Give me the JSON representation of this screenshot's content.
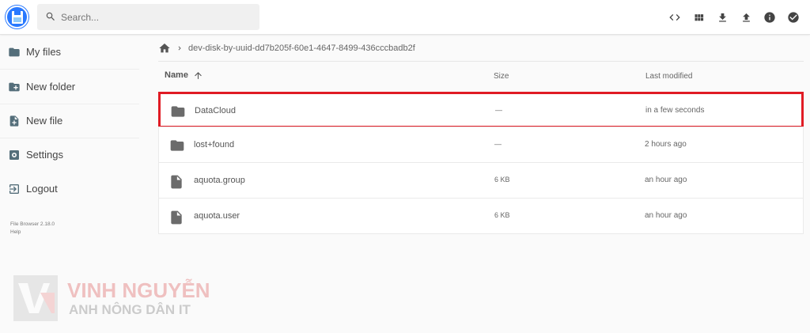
{
  "search": {
    "placeholder": "Search..."
  },
  "header_actions": [
    "code-icon",
    "grid-view-icon",
    "download-icon",
    "upload-icon",
    "info-icon",
    "select-check-icon"
  ],
  "sidebar": {
    "items": [
      {
        "label": "My files",
        "icon": "folder-icon"
      },
      {
        "label": "New folder",
        "icon": "create-folder-icon"
      },
      {
        "label": "New file",
        "icon": "note-add-icon"
      },
      {
        "label": "Settings",
        "icon": "settings-icon"
      },
      {
        "label": "Logout",
        "icon": "logout-icon"
      }
    ],
    "version": "File Browser 2.18.0",
    "help": "Help"
  },
  "breadcrumb": {
    "path": "dev-disk-by-uuid-dd7b205f-60e1-4647-8499-436cccbadb2f"
  },
  "columns": {
    "name": "Name",
    "size": "Size",
    "modified": "Last modified"
  },
  "files": [
    {
      "name": "DataCloud",
      "type": "folder",
      "size": "—",
      "modified": "in a few seconds",
      "highlighted": true
    },
    {
      "name": "lost+found",
      "type": "folder",
      "size": "—",
      "modified": "2 hours ago",
      "highlighted": false
    },
    {
      "name": "aquota.group",
      "type": "file",
      "size": "6 KB",
      "modified": "an hour ago",
      "highlighted": false
    },
    {
      "name": "aquota.user",
      "type": "file",
      "size": "6 KB",
      "modified": "an hour ago",
      "highlighted": false
    }
  ],
  "watermark": {
    "line1": "VINH NGUYỄN",
    "line2": "ANH NÔNG DÂN IT"
  },
  "colors": {
    "accent": "#2979ff",
    "highlight": "#e01b24",
    "icon": "#546e7a"
  }
}
